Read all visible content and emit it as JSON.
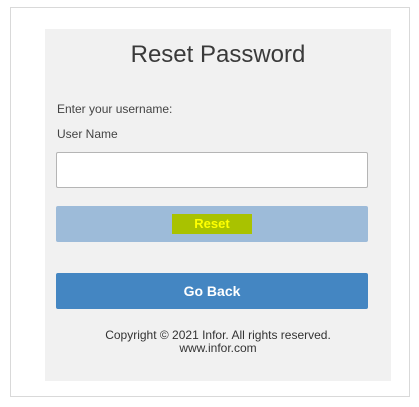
{
  "form": {
    "title": "Reset Password",
    "prompt": "Enter your username:",
    "username_label": "User Name",
    "username_value": "",
    "reset_label": "Reset",
    "go_back_label": "Go Back"
  },
  "footer": {
    "copyright": "Copyright © 2021 Infor. All rights reserved.",
    "website": "www.infor.com"
  },
  "colors": {
    "panel_background": "#f1f1f1",
    "reset_button": "#9dbbd9",
    "reset_highlight": "#a9c200",
    "reset_text": "#ffff00",
    "go_back_button": "#4486c2"
  }
}
